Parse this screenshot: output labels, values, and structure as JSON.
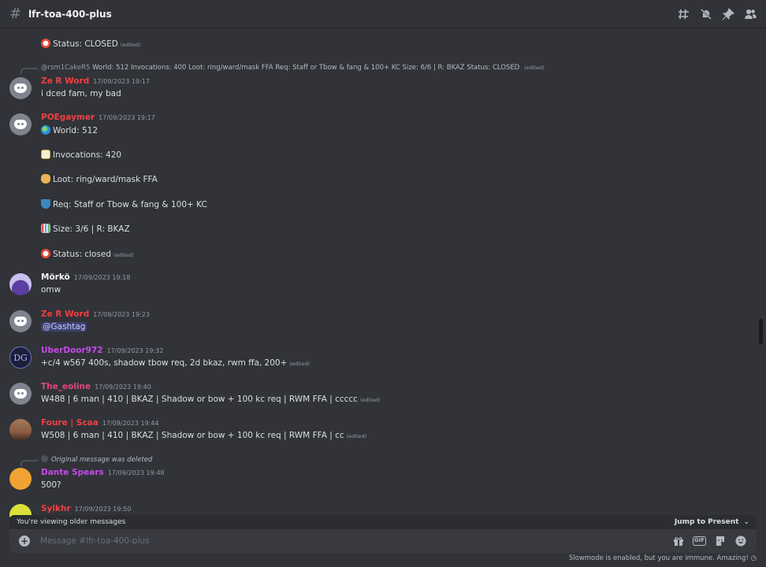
{
  "channel": {
    "hash": "#",
    "name": "lfr-toa-400-plus"
  },
  "header_icons": [
    "threads-icon",
    "mute-icon",
    "pin-icon",
    "members-icon"
  ],
  "messages": {
    "m0": {
      "status": "Status: CLOSED",
      "edited": "(edited)"
    },
    "m1": {
      "reply_author": "@rsm1CakeRS",
      "reply_text": "World: 512 Invocations: 400 Loot: ring/ward/mask FFA Req: Staff or Tbow & fang & 100+ KC Size: 6/6 | R: BKAZ Status: CLOSED",
      "reply_edited": "(edited)",
      "username": "Ze R Word",
      "username_color": "#f23f43",
      "timestamp": "17/09/2023 19:17",
      "text": "i dced fam, my bad"
    },
    "m2": {
      "username": "POEgaymer",
      "username_color": "#f23f43",
      "timestamp": "17/09/2023 19:17",
      "lines": [
        "World: 512",
        "Invocations:  420",
        "Loot: ring/ward/mask FFA",
        "Req: Staff or Tbow & fang & 100+ KC",
        "Size: 3/6 |  R: BKAZ",
        "Status: closed"
      ],
      "edited": "(edited)"
    },
    "m3": {
      "username": "Mörkö",
      "username_color": "#f2f3f5",
      "timestamp": "17/09/2023 19:18",
      "text": "omw"
    },
    "m4": {
      "username": "Ze R Word",
      "username_color": "#f23f43",
      "timestamp": "17/09/2023 19:23",
      "mention": "@Gashtag"
    },
    "m5": {
      "username": "UberDoor972",
      "username_color": "#c64be8",
      "timestamp": "17/09/2023 19:32",
      "text": "+c/4 w567 400s, shadow tbow req, 2d bkaz, rwm ffa, 200+",
      "edited": "(edited)",
      "avatar_text": "DG"
    },
    "m6": {
      "username": "The_eoline",
      "username_color": "#e8457c",
      "timestamp": "17/09/2023 19:40",
      "text": "W488 | 6 man | 410 | BKAZ | Shadow  or bow + 100 kc req | RWM FFA | ccccc",
      "edited": "(edited)"
    },
    "m7": {
      "username": "Foure | Scaa",
      "username_color": "#f23f43",
      "timestamp": "17/09/2023 19:44",
      "text": "W508 | 6 man | 410 | BKAZ | Shadow  or bow + 100 kc req | RWM FFA | cc",
      "edited": "(edited)"
    },
    "m8": {
      "reply_text": "Original message was deleted",
      "username": "Dante Spears",
      "username_color": "#c64be8",
      "timestamp": "17/09/2023 19:48",
      "text": "500?"
    },
    "m9": {
      "username": "Sylkhr",
      "username_color": "#f23f43",
      "timestamp": "17/09/2023 19:50"
    }
  },
  "older_bar": {
    "text": "You're viewing older messages",
    "jump": "Jump to Present"
  },
  "composer": {
    "placeholder": "Message #lfr-toa-400-plus",
    "gif_label": "GIF"
  },
  "slowmode": "Slowmode is enabled, but you are immune. Amazing!"
}
